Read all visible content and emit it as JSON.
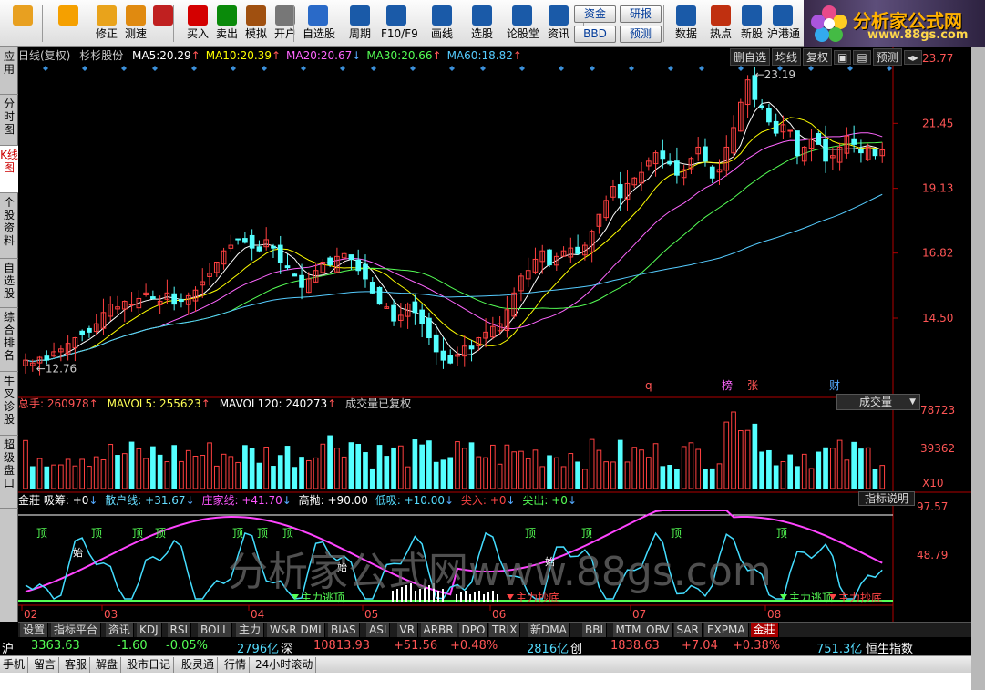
{
  "toolbar": {
    "buttons": [
      {
        "label": "",
        "icon": "windows-grid-icon",
        "color": "#e8a020"
      },
      {
        "label": "",
        "icon": "back-arrow-icon",
        "color": "#f5a000"
      },
      {
        "label": "修正",
        "icon": "up-down-arrows-icon",
        "color": "#e9a31b"
      },
      {
        "label": "测速",
        "icon": "speed-icon",
        "color": "#e08a10"
      },
      {
        "label": "",
        "icon": "clock-icon",
        "color": "#c02020"
      },
      {
        "label": "买入",
        "icon": "buy-icon",
        "color": "#d40000"
      },
      {
        "label": "卖出",
        "icon": "sell-icon",
        "color": "#0a8a0a"
      },
      {
        "label": "模拟",
        "icon": "hammer-icon",
        "color": "#a05010"
      },
      {
        "label": "开户",
        "icon": "lock-icon",
        "color": "#777"
      },
      {
        "label": "自选股",
        "icon": "star-folder-icon",
        "color": "#2a6ac8"
      },
      {
        "label": "周期",
        "icon": "cycle-icon",
        "color": "#1a5aa8"
      },
      {
        "label": "F10/F9",
        "icon": "f10-icon",
        "color": "#1a5aa8"
      },
      {
        "label": "画线",
        "icon": "pencil-icon",
        "color": "#1a5aa8"
      },
      {
        "label": "选股",
        "icon": "select-stock-icon",
        "color": "#1a5aa8"
      },
      {
        "label": "论股堂",
        "icon": "forum-icon",
        "color": "#1a5aa8"
      },
      {
        "label": "资讯",
        "icon": "news-icon",
        "color": "#1a5aa8"
      },
      {
        "label": "数据",
        "icon": "pe-icon",
        "color": "#1a5aa8"
      },
      {
        "label": "热点",
        "icon": "hot-icon",
        "color": "#c03010"
      },
      {
        "label": "新股",
        "icon": "ipo-icon",
        "color": "#1a5aa8"
      },
      {
        "label": "沪港通",
        "icon": "hk-connect-icon",
        "color": "#1a5aa8"
      }
    ],
    "fund_btn": "资金",
    "bbd_btn": "BBD",
    "research_btn": "研报",
    "forecast_btn": "预测",
    "top_labels": {
      "watchlist": "自选股",
      "buy": "买入",
      "sell": "卖出"
    }
  },
  "logo": {
    "title": "分析家公式网",
    "url": "www.88gs.com"
  },
  "left_tabs": [
    "应用",
    "分时图",
    "K线图",
    "个股资料",
    "自选股",
    "综合排名",
    "牛叉诊股",
    "超级盘口"
  ],
  "chart_header": {
    "label": "日线(复权)",
    "stock": "杉杉股份",
    "ma": [
      {
        "name": "MA5:",
        "value": "20.29",
        "color": "#ffffff"
      },
      {
        "name": "MA10:",
        "value": "20.39",
        "color": "#ffff00"
      },
      {
        "name": "MA20:",
        "value": "20.67",
        "color": "#ff66ff"
      },
      {
        "name": "MA30:",
        "value": "20.66",
        "color": "#55ff55"
      },
      {
        "name": "MA60:",
        "value": "18.82",
        "color": "#55ccff"
      }
    ],
    "buttons": [
      "删自选",
      "均线",
      "复权",
      "",
      "",
      "预测",
      ""
    ]
  },
  "vol_header": {
    "total": "总手: 260978",
    "mavol5": "MAVOL5: 255623",
    "mavol120": "MAVOL120: 240273",
    "note": "成交量已复权",
    "dropdown": "成交量"
  },
  "ind_header": {
    "name": "金莊",
    "xichou": "吸筹: +0",
    "sanhu": "散户线: +31.67",
    "zhuangjia": "庄家线: +41.70",
    "gaopao": "高抛: +90.00",
    "dixi": "低吸: +10.00",
    "jianru": "尖入: +0",
    "jianchu": "尖出: +0",
    "help": "指标说明"
  },
  "y_axis": {
    "price": [
      "23.77",
      "21.45",
      "19.13",
      "16.82",
      "14.50"
    ],
    "vol": [
      "78723",
      "39362",
      "X10"
    ],
    "ind": [
      "97.57",
      "48.79"
    ]
  },
  "x_axis": [
    "02",
    "03",
    "04",
    "05",
    "06",
    "07",
    "08"
  ],
  "annotations": {
    "high": "23.19",
    "low": "12.76",
    "marks": [
      "q",
      "榜",
      "张",
      "财"
    ],
    "top_label": "顶",
    "bottom_label": "始",
    "main_escape": "主力逃顶",
    "main_bottom": "主力抄底"
  },
  "watermark": "分析家公式网www.88gs.com",
  "tabs": [
    "设置",
    "指标平台",
    "资讯",
    "KDJ",
    "RSI",
    "BOLL",
    "主力",
    "W&R",
    "DMI",
    "BIAS",
    "ASI",
    "VR",
    "ARBR",
    "DPO",
    "TRIX",
    "新DMA",
    "BBI",
    "MTM",
    "OBV",
    "SAR",
    "EXPMA",
    "金莊"
  ],
  "ticker": {
    "sh_label": "沪",
    "sh_index": "3363.63",
    "sh_change": "-1.60",
    "sh_pct": "-0.05%",
    "sh_amount": "2796亿",
    "sz_label": "深",
    "sz_index": "10813.93",
    "sz_change": "+51.56",
    "sz_pct": "+0.48%",
    "sz_amount": "2816亿",
    "cy_label": "创",
    "cy_index": "1838.63",
    "cy_change": "+7.04",
    "cy_pct": "+0.38%",
    "cy_amount": "751.3亿",
    "hk_label": "恒生指数"
  },
  "status_tabs": [
    "手机",
    "留言",
    "客服",
    "解盘",
    "股市日记",
    "股灵通",
    "行情",
    "24小时滚动"
  ],
  "chart_data": {
    "type": "candlestick",
    "price_range": [
      11.8,
      23.77
    ],
    "annotations": {
      "high": 23.19,
      "low": 12.76
    },
    "ma": {
      "MA5": 20.29,
      "MA10": 20.39,
      "MA20": 20.67,
      "MA30": 20.66,
      "MA60": 18.82
    },
    "y_ticks": [
      23.77,
      21.45,
      19.13,
      16.82,
      14.5
    ],
    "months": [
      "02",
      "03",
      "04",
      "05",
      "06",
      "07",
      "08"
    ],
    "close_path": [
      13.0,
      12.9,
      13.1,
      13.0,
      13.3,
      13.4,
      13.6,
      13.8,
      13.9,
      14.0,
      14.3,
      14.7,
      15.0,
      14.9,
      15.1,
      15.0,
      15.2,
      15.4,
      15.2,
      15.1,
      15.4,
      15.0,
      15.1,
      15.3,
      15.5,
      15.8,
      16.1,
      16.5,
      16.9,
      17.1,
      17.3,
      17.2,
      17.0,
      16.9,
      17.3,
      17.0,
      16.5,
      16.3,
      16.0,
      15.6,
      15.9,
      16.2,
      16.5,
      16.4,
      16.7,
      16.8,
      16.6,
      16.2,
      15.9,
      15.4,
      15.0,
      14.9,
      14.4,
      14.6,
      15.0,
      14.7,
      14.3,
      13.8,
      13.3,
      13.0,
      12.9,
      13.2,
      13.5,
      13.4,
      13.8,
      14.0,
      14.2,
      14.3,
      14.8,
      15.4,
      16.0,
      16.2,
      16.6,
      16.9,
      16.4,
      16.7,
      16.9,
      17.0,
      16.8,
      17.1,
      17.6,
      18.2,
      18.7,
      19.2,
      18.8,
      19.3,
      19.5,
      19.7,
      20.1,
      20.4,
      20.2,
      20.0,
      19.6,
      19.8,
      20.2,
      20.6,
      20.1,
      19.5,
      19.8,
      20.6,
      21.3,
      22.2,
      23.0,
      22.3,
      22.0,
      21.5,
      21.1,
      21.4,
      21.2,
      20.3,
      20.6,
      20.9,
      20.7,
      20.1,
      20.3,
      20.6,
      21.0,
      20.7,
      20.4,
      20.6,
      20.3,
      20.5
    ]
  }
}
